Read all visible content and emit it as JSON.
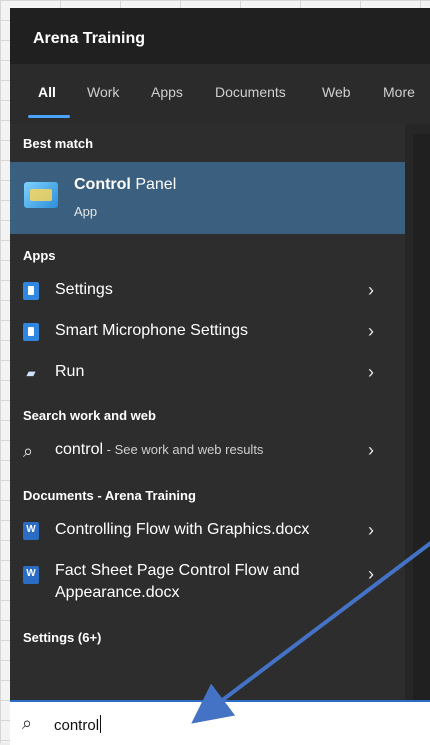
{
  "header": {
    "org_title": "Arena Training"
  },
  "tabs": [
    {
      "label": "All"
    },
    {
      "label": "Work"
    },
    {
      "label": "Apps"
    },
    {
      "label": "Documents"
    },
    {
      "label": "Web"
    },
    {
      "label": "More"
    }
  ],
  "sections": {
    "best_match": "Best match",
    "apps": "Apps",
    "search_web": "Search work and web",
    "documents": "Documents - Arena Training",
    "settings": "Settings (6+)"
  },
  "best_match": {
    "title_bold": "Control",
    "title_rest": " Panel",
    "subtitle": "App",
    "icon": "control-panel-icon"
  },
  "apps": [
    {
      "label": "Settings",
      "icon": "settings-app-icon"
    },
    {
      "label": "Smart Microphone Settings",
      "icon": "settings-app-icon"
    },
    {
      "label": "Run",
      "icon": "run-icon"
    }
  ],
  "web_search": {
    "query": "control",
    "suffix": " - See work and web results",
    "icon": "search-icon"
  },
  "documents": [
    {
      "label": "Controlling Flow with Graphics.docx",
      "icon": "word-doc-icon"
    },
    {
      "label": "Fact Sheet Page Control Flow and Appearance.docx",
      "icon": "word-doc-icon"
    }
  ],
  "search": {
    "value": "control"
  },
  "colors": {
    "highlight": "#3b5f7f",
    "accent": "#4aa3ff",
    "annotation_arrow": "#4472c4"
  }
}
